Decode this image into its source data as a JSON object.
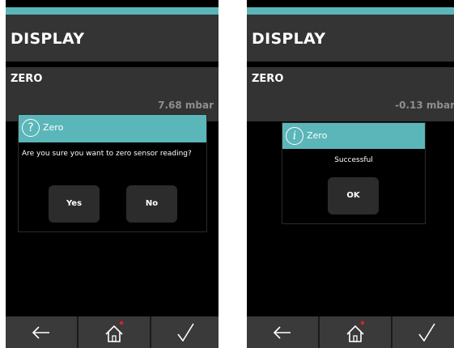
{
  "left": {
    "title": "DISPLAY",
    "zero_label": "ZERO",
    "reading": "7.68 mbar",
    "dialog": {
      "title": "Zero",
      "icon": "question-icon",
      "message": "Are you sure you want to zero sensor reading?",
      "yes_label": "Yes",
      "no_label": "No"
    }
  },
  "right": {
    "title": "DISPLAY",
    "zero_label": "ZERO",
    "reading": "-0.13 mbar",
    "dialog": {
      "title": "Zero",
      "icon": "info-icon",
      "message": "Successful",
      "ok_label": "OK"
    }
  },
  "footer": {
    "icons": [
      "back-arrow-icon",
      "home-icon",
      "check-icon"
    ]
  },
  "colors": {
    "accent": "#5bb6b9",
    "panel": "#333333",
    "background": "#000000",
    "footer": "#3a3a3a",
    "home_dot": "#e02020"
  }
}
